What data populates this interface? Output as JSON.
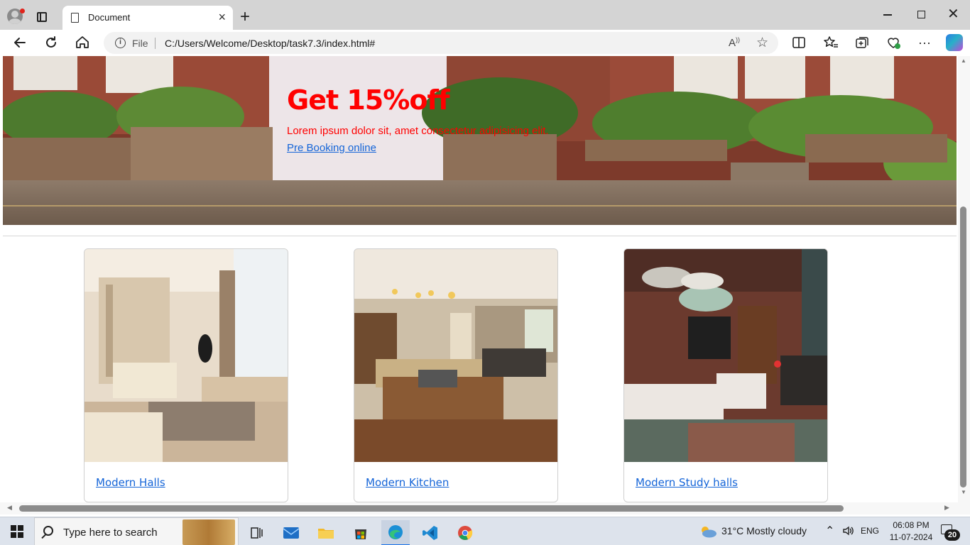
{
  "browser": {
    "tab_title": "Document",
    "address_scheme": "File",
    "address_url": "C:/Users/Welcome/Desktop/task7.3/index.html#"
  },
  "hero": {
    "title": "Get 15%off",
    "text": "Lorem ipsum dolor sit, amet consectetur adipisicing elit.",
    "link": "Pre Booking online"
  },
  "cards": [
    {
      "label": "Modern Halls"
    },
    {
      "label": "Modern Kitchen"
    },
    {
      "label": "Modern Study halls"
    }
  ],
  "taskbar": {
    "search_placeholder": "Type here to search",
    "weather": "31°C  Mostly cloudy",
    "language": "ENG",
    "time": "06:08 PM",
    "date": "11-07-2024",
    "notification_count": "20"
  },
  "colors": {
    "hero_text": "#ff0000",
    "link": "#1565d8",
    "taskbar": "#dde3ec"
  }
}
